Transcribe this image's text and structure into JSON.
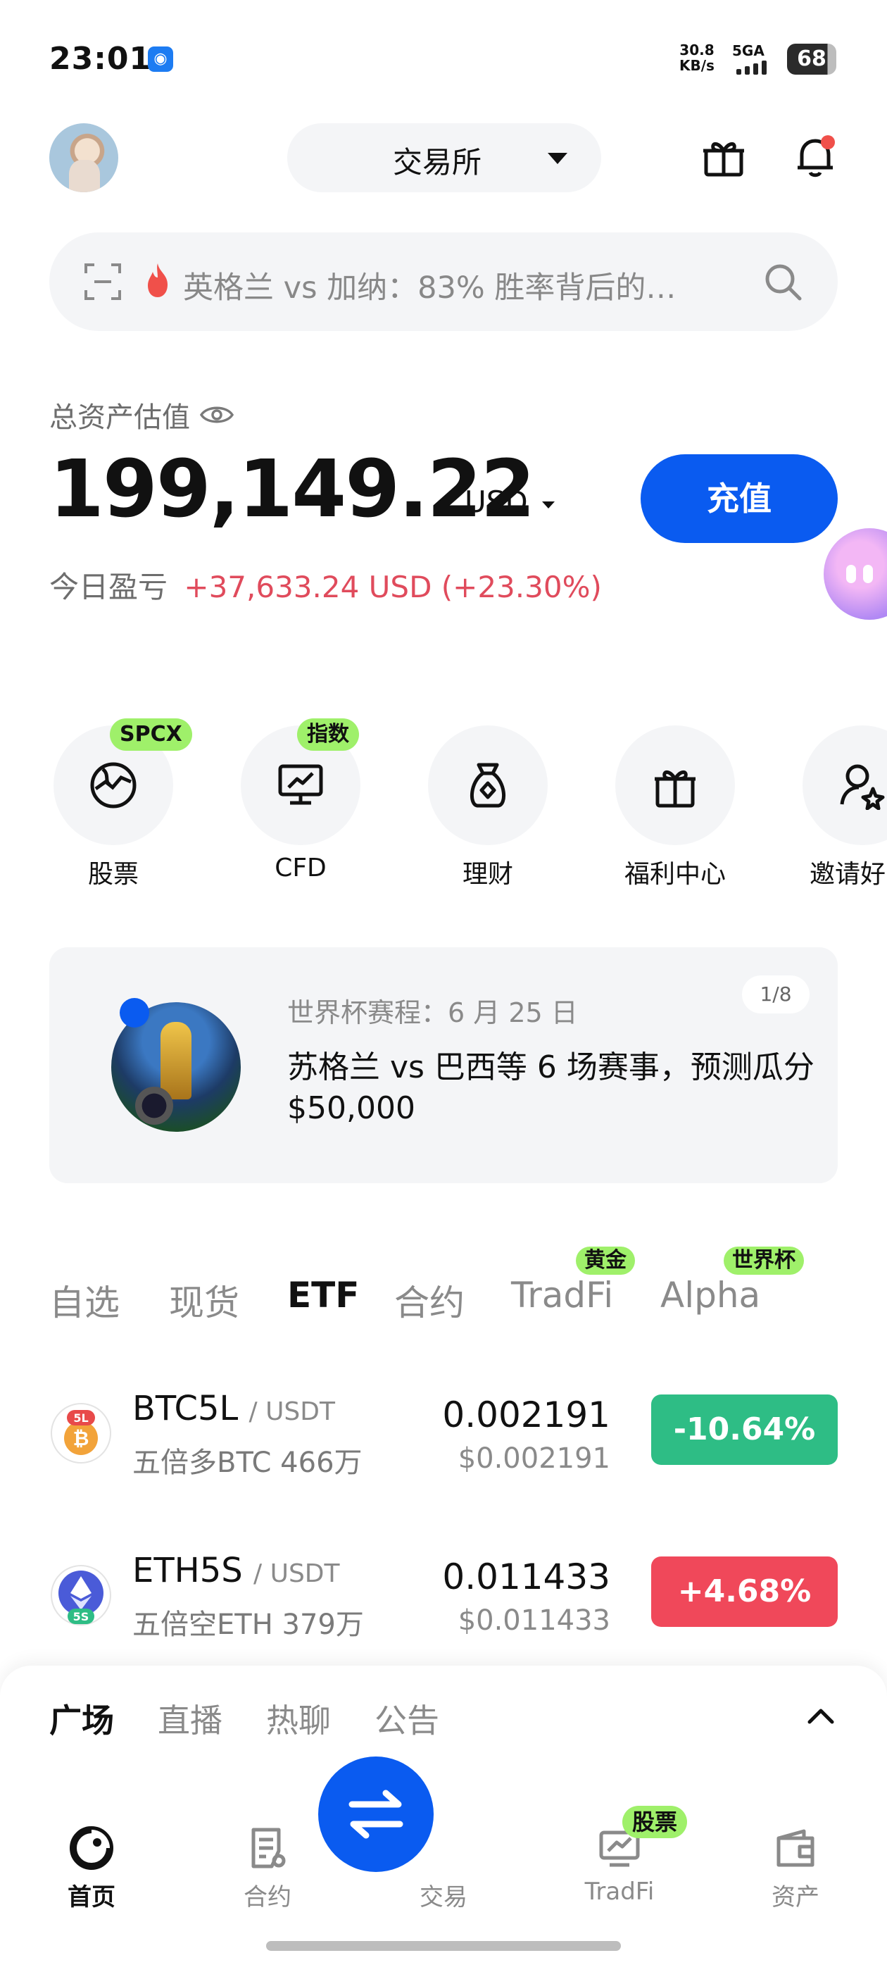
{
  "status_bar": {
    "time": "23:01",
    "network_speed": "30.8",
    "network_unit": "KB/s",
    "signal_label": "5GA",
    "battery": "68"
  },
  "header": {
    "exchange_label": "交易所",
    "notification_dot": true
  },
  "search": {
    "text": "英格兰 vs 加纳：83% 胜率背后的…"
  },
  "balance": {
    "label": "总资产估值",
    "amount": "199,149.22",
    "currency": "USD",
    "deposit_label": "充值",
    "pnl_label": "今日盈亏",
    "pnl_value": "+37,633.24 USD (+23.30%)"
  },
  "quick_entries": [
    {
      "label": "股票",
      "icon": "globe-chart-icon",
      "badge": "SPCX"
    },
    {
      "label": "CFD",
      "icon": "monitor-chart-icon",
      "badge": "指数"
    },
    {
      "label": "理财",
      "icon": "money-bag-icon",
      "badge": ""
    },
    {
      "label": "福利中心",
      "icon": "gift-icon",
      "badge": ""
    },
    {
      "label": "邀请好",
      "icon": "invite-user-icon",
      "badge": ""
    }
  ],
  "banner": {
    "subtitle": "世界杯赛程：6 月 25 日",
    "title": "苏格兰 vs 巴西等 6 场赛事，预测瓜分 $50,000",
    "page": "1/8"
  },
  "market_tabs": [
    {
      "label": "自选",
      "active": false,
      "badge": ""
    },
    {
      "label": "现货",
      "active": false,
      "badge": ""
    },
    {
      "label": "ETF",
      "active": true,
      "badge": ""
    },
    {
      "label": "合约",
      "active": false,
      "badge": ""
    },
    {
      "label": "TradFi",
      "active": false,
      "badge": "黄金"
    },
    {
      "label": "Alpha",
      "active": false,
      "badge": "世界杯"
    }
  ],
  "market_rows": [
    {
      "symbol": "BTC5L",
      "quote": "/ USDT",
      "desc": "五倍多BTC 466万",
      "price": "0.002191",
      "price_usd": "$0.002191",
      "change": "-10.64%",
      "direction": "down",
      "icon_text": "5L"
    },
    {
      "symbol": "ETH5S",
      "quote": "/ USDT",
      "desc": "五倍空ETH 379万",
      "price": "0.011433",
      "price_usd": "$0.011433",
      "change": "+4.68%",
      "direction": "up",
      "icon_text": "5S"
    }
  ],
  "feed_tabs": [
    {
      "label": "广场",
      "active": true
    },
    {
      "label": "直播",
      "active": false
    },
    {
      "label": "热聊",
      "active": false
    },
    {
      "label": "公告",
      "active": false
    }
  ],
  "bottom_nav": [
    {
      "label": "首页",
      "active": true
    },
    {
      "label": "合约",
      "active": false
    },
    {
      "label": "交易",
      "active": false
    },
    {
      "label": "TradFi",
      "active": false,
      "badge": "股票"
    },
    {
      "label": "资产",
      "active": false
    }
  ],
  "colors": {
    "accent": "#0a5bf0",
    "up": "#f0485a",
    "down": "#2ebd85",
    "badge": "#9ff06a"
  }
}
